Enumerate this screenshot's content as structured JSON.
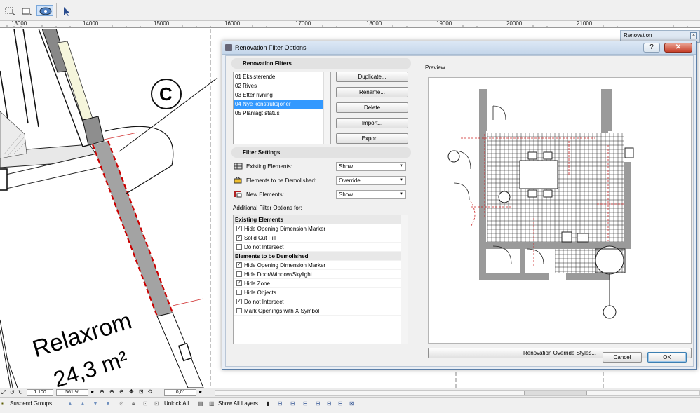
{
  "top_toolbar": {
    "icons": [
      "marquee-icon",
      "rect-icon",
      "rotate-icon",
      "arrow-pointer-icon"
    ]
  },
  "ruler": {
    "ticks": [
      "13000",
      "14000",
      "15000",
      "16000",
      "17000",
      "18000",
      "19000",
      "20000",
      "21000"
    ]
  },
  "plan": {
    "room_label": "Relaxrom",
    "room_area": "24,3 m²",
    "section_marker": "C"
  },
  "renovation_palette": {
    "title": "Renovation"
  },
  "dialog": {
    "title": "Renovation Filter Options",
    "close_glyph": "✕",
    "renovation_filters_header": "Renovation Filters",
    "filters": [
      "01 Eksisterende",
      "02 Rives",
      "03 Etter rivning",
      "04 Nye konstruksjoner",
      "05 Planlagt status"
    ],
    "selected_filter": "04 Nye konstruksjoner",
    "buttons": {
      "duplicate": "Duplicate...",
      "rename": "Rename...",
      "delete": "Delete",
      "import": "Import...",
      "export": "Export..."
    },
    "filter_settings_header": "Filter Settings",
    "settings": [
      {
        "label": "Existing Elements:",
        "value": "Show",
        "icon": "existing-elements-icon"
      },
      {
        "label": "Elements to be Demolished:",
        "value": "Override",
        "icon": "demolish-icon"
      },
      {
        "label": "New Elements:",
        "value": "Show",
        "icon": "new-elements-icon"
      }
    ],
    "additional_label": "Additional Filter Options for:",
    "existing_header": "Existing Elements",
    "existing_options": [
      {
        "label": "Hide Opening Dimension Marker",
        "checked": true
      },
      {
        "label": "Solid Cut Fill",
        "checked": true
      },
      {
        "label": "Do not Intersect",
        "checked": false
      }
    ],
    "demolished_header": "Elements to be Demolished",
    "demolished_options": [
      {
        "label": "Hide Opening Dimension Marker",
        "checked": true
      },
      {
        "label": "Hide Door/Window/Skylight",
        "checked": false
      },
      {
        "label": "Hide Zone",
        "checked": true
      },
      {
        "label": "Hide Objects",
        "checked": false
      },
      {
        "label": "Do not Intersect",
        "checked": true
      },
      {
        "label": "Mark Openings with X Symbol",
        "checked": false
      }
    ],
    "preview_label": "Preview",
    "override_button": "Renovation Override Styles...",
    "cancel": "Cancel",
    "ok": "OK"
  },
  "nav_bar": {
    "scale": "1:100",
    "zoom": "561 %",
    "angle": "0,0°"
  },
  "bottom_toolbar": {
    "suspend_groups": "Suspend Groups",
    "unlock_all": "Unlock All",
    "show_all_layers": "Show All Layers"
  },
  "colors": {
    "accent": "#3399ff",
    "title_bar": "#c4d6ea",
    "red_dash": "#cc0000",
    "wall_gray": "#9a9a9a"
  }
}
